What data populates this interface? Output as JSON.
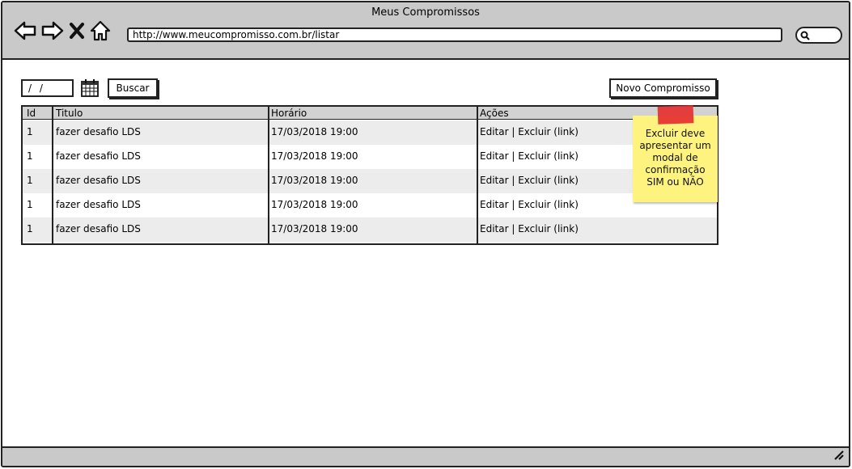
{
  "window": {
    "title": "Meus Compromissos",
    "url": "http://www.meucompromisso.com.br/listar"
  },
  "toolbar": {
    "date_value": "/ /",
    "search_label": "Buscar",
    "new_label": "Novo Compromisso"
  },
  "table": {
    "headers": [
      "Id",
      "Titulo",
      "Horário",
      "Ações"
    ],
    "rows": [
      [
        "1",
        "fazer desafio LDS",
        "17/03/2018 19:00",
        "Editar | Excluir (link)"
      ],
      [
        "1",
        "fazer desafio LDS",
        "17/03/2018 19:00",
        "Editar | Excluir (link)"
      ],
      [
        "1",
        "fazer desafio LDS",
        "17/03/2018 19:00",
        "Editar | Excluir (link)"
      ],
      [
        "1",
        "fazer desafio LDS",
        "17/03/2018 19:00",
        "Editar | Excluir (link)"
      ],
      [
        "1",
        "fazer desafio LDS",
        "17/03/2018 19:00",
        "Editar | Excluir (link)"
      ]
    ]
  },
  "note": {
    "text": "Excluir deve apresentar um modal de confirmação SIM ou NÃO",
    "color": "#fff380",
    "tape_color": "#e53030"
  },
  "icons": {
    "back": "arrow-left-icon",
    "forward": "arrow-right-icon",
    "stop": "close-icon",
    "home": "home-icon",
    "search": "search-icon",
    "calendar": "calendar-icon"
  }
}
